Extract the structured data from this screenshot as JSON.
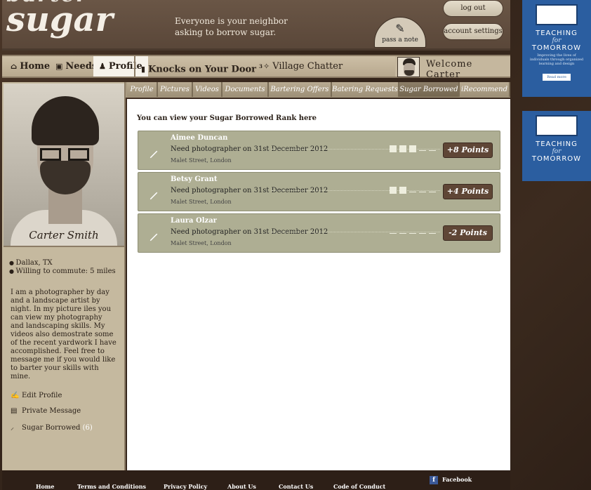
{
  "header": {
    "logo_line1": "barter",
    "logo_line2": "sugar",
    "tagline": "Everyone is your neighbor asking to borrow sugar.",
    "pass_note": "pass a note",
    "logout": "log out",
    "account_settings": "account settings"
  },
  "nav": {
    "items": [
      {
        "label": "Home",
        "icon": "house-icon"
      },
      {
        "label": "Needs",
        "icon": "needs-icon"
      },
      {
        "label": "Profile",
        "icon": "person-icon"
      },
      {
        "label": "Knocks on Your Door",
        "icon": "door-icon"
      },
      {
        "label": "Village Chatter",
        "icon": "chatter-icon"
      }
    ],
    "knocks_badge": "3",
    "welcome": "Welcome  Carter"
  },
  "profile": {
    "name": "Carter Smith",
    "location": "Dallax, TX",
    "commute": "Willing to commute: 5 miles",
    "bio": "I am a photographer by day and a landscape artist by night. In my picture iles you can view my photography and landscaping skills. My videos also demostrate some of the recent yardwork I have accomplished. Feel free to message me if you would like to barter your skills with mine.",
    "actions": {
      "edit": "Edit Profile",
      "message": "Private Message",
      "sugar": "Sugar Borrowed",
      "sugar_count": "(6)"
    }
  },
  "tabs": [
    "Profile",
    "Pictures",
    "Videos",
    "Documents",
    "Bartering Offers",
    "Batering Requests",
    "Sugar Borrowed",
    "iRecommend"
  ],
  "main": {
    "rank_text": "You can view your Sugar Borrowed Rank here",
    "entries": [
      {
        "name": "Aimee Duncan",
        "desc": "Need photographer on 31st December 2012",
        "location": "Malet Street, London",
        "points": "+8 Points",
        "rating": 3
      },
      {
        "name": "Betsy Grant",
        "desc": "Need photographer on 31st December 2012",
        "location": "Malet Street, London",
        "points": "+4 Points",
        "rating": 2
      },
      {
        "name": "Laura Olzar",
        "desc": "Need photographer on 31st December 2012",
        "location": "Malet Street, London",
        "points": "-2 Points",
        "rating": 0
      }
    ]
  },
  "footer": {
    "links": [
      "Home",
      "Terms and Conditions",
      "Privacy Policy",
      "About Us",
      "Contact Us",
      "Code of Conduct"
    ],
    "facebook": "Facebook"
  },
  "ads": [
    {
      "title": "TEACHING",
      "for": "for",
      "sub": "TOMORROW",
      "small": "Improving the lives of individuals through organized learning and design",
      "button": "Read more"
    },
    {
      "title": "TEACHING",
      "for": "for",
      "sub": "TOMORROW"
    }
  ],
  "colors": {
    "panel": "#c5b99f",
    "row": "#aeae93",
    "points": "#5f4636",
    "ad": "#2b5ea0"
  }
}
